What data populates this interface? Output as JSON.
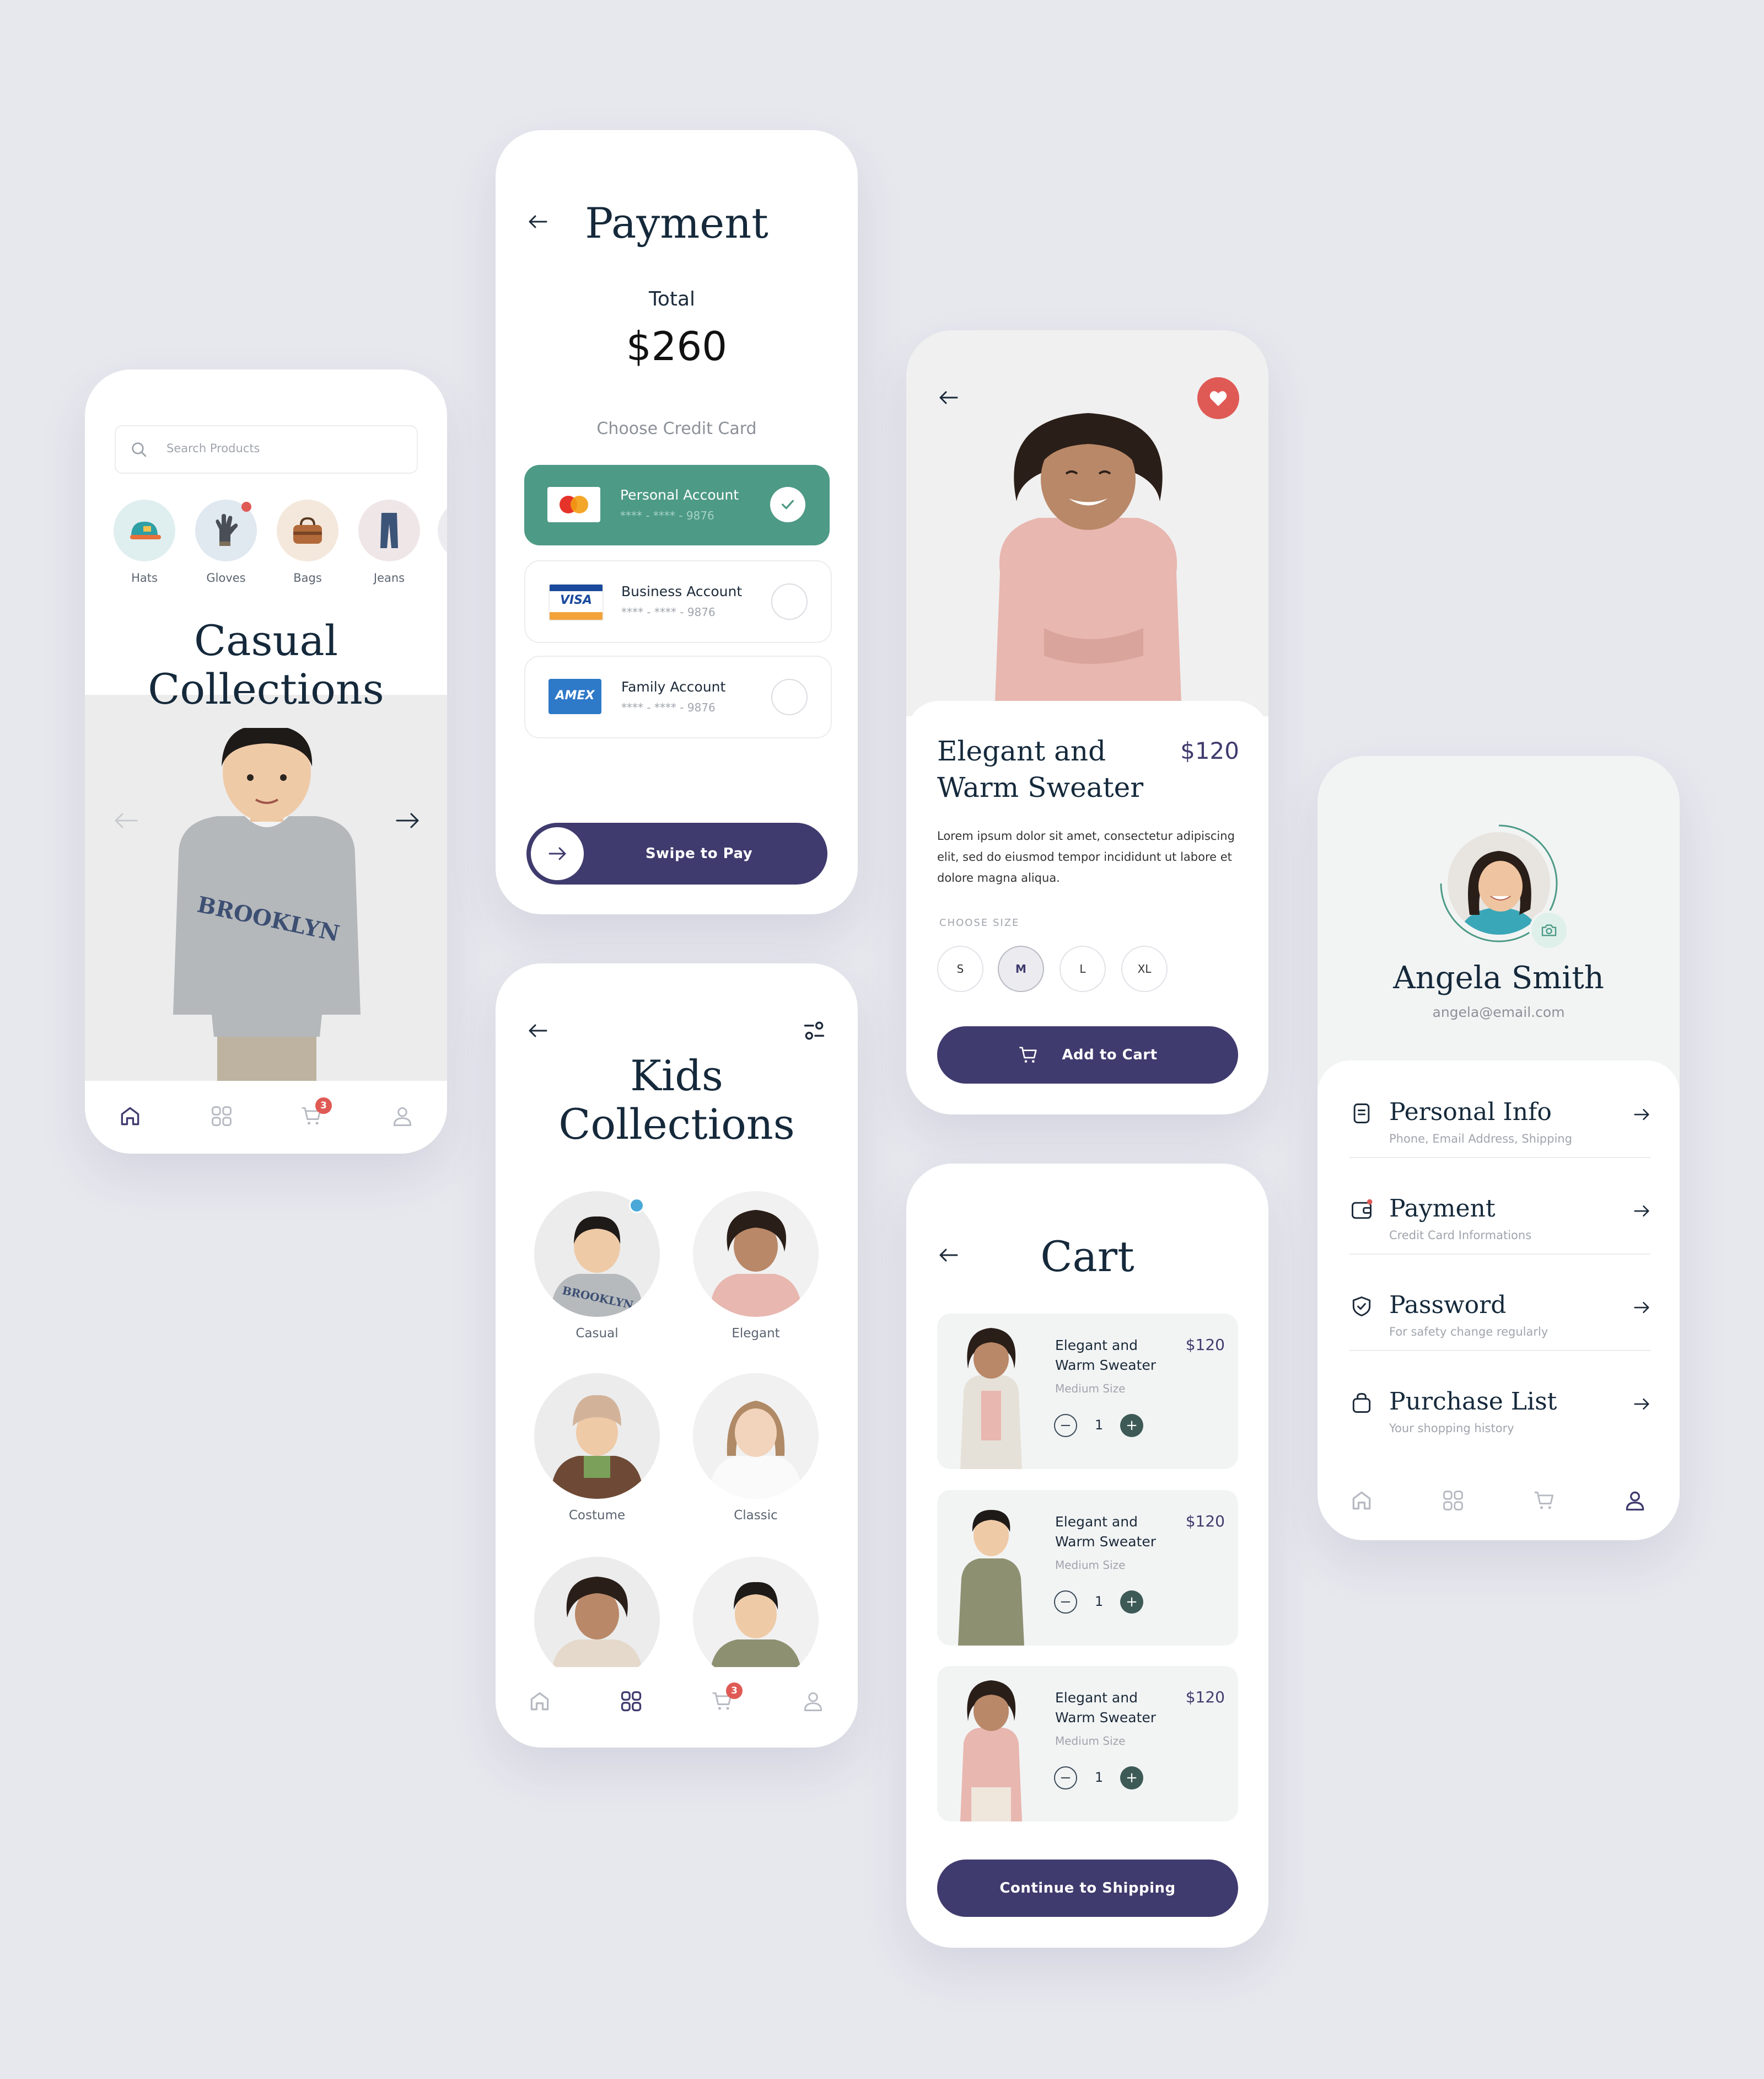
{
  "home": {
    "search_placeholder": "Search Products",
    "categories": [
      {
        "label": "Hats"
      },
      {
        "label": "Gloves"
      },
      {
        "label": "Bags"
      },
      {
        "label": "Jeans"
      }
    ],
    "title_line1": "Casual",
    "title_line2": "Collections",
    "shirt_text": "BROOKLYN",
    "cart_badge": "3"
  },
  "payment": {
    "title": "Payment",
    "total_label": "Total",
    "total_value": "$260",
    "choose_label": "Choose Credit Card",
    "cards": [
      {
        "name": "Personal Account",
        "number": "**** - **** - 9876",
        "brand_text": ""
      },
      {
        "name": "Business Account",
        "number": "**** - **** - 9876",
        "brand_text": "VISA"
      },
      {
        "name": "Family Account",
        "number": "**** - **** - 9876",
        "brand_text": "AMEX"
      }
    ],
    "swipe_label": "Swipe to Pay"
  },
  "kids": {
    "title_line1": "Kids",
    "title_line2": "Collections",
    "items": [
      {
        "label": "Casual"
      },
      {
        "label": "Elegant"
      },
      {
        "label": "Costume"
      },
      {
        "label": "Classic"
      }
    ],
    "cart_badge": "3"
  },
  "product": {
    "name_line1": "Elegant and",
    "name_line2": "Warm Sweater",
    "price": "$120",
    "description": "Lorem ipsum dolor sit amet, consectetur adipiscing elit, sed do eiusmod tempor incididunt ut labore et dolore magna aliqua.",
    "size_label": "CHOOSE SIZE",
    "sizes": [
      "S",
      "M",
      "L",
      "XL"
    ],
    "selected_size": "M",
    "add_to_cart": "Add to Cart"
  },
  "cart": {
    "title": "Cart",
    "items": [
      {
        "name_line1": "Elegant and",
        "name_line2": "Warm Sweater",
        "price": "$120",
        "size": "Medium Size",
        "qty": "1"
      },
      {
        "name_line1": "Elegant and",
        "name_line2": "Warm Sweater",
        "price": "$120",
        "size": "Medium Size",
        "qty": "1"
      },
      {
        "name_line1": "Elegant and",
        "name_line2": "Warm Sweater",
        "price": "$120",
        "size": "Medium Size",
        "qty": "1"
      }
    ],
    "continue_label": "Continue to Shipping"
  },
  "profile": {
    "name": "Angela Smith",
    "email": "angela@email.com",
    "menu": [
      {
        "title": "Personal Info",
        "subtitle": "Phone, Email Address, Shipping",
        "icon": "document-icon"
      },
      {
        "title": "Payment",
        "subtitle": "Credit Card Informations",
        "icon": "wallet-icon"
      },
      {
        "title": "Password",
        "subtitle": "For safety change regularly",
        "icon": "shield-icon"
      },
      {
        "title": "Purchase List",
        "subtitle": "Your shopping history",
        "icon": "bag-icon"
      }
    ]
  },
  "colors": {
    "primary": "#3f3b6e",
    "accent_green": "#4d9a86",
    "badge_red": "#e05a55",
    "background": "#e7e7ee"
  }
}
